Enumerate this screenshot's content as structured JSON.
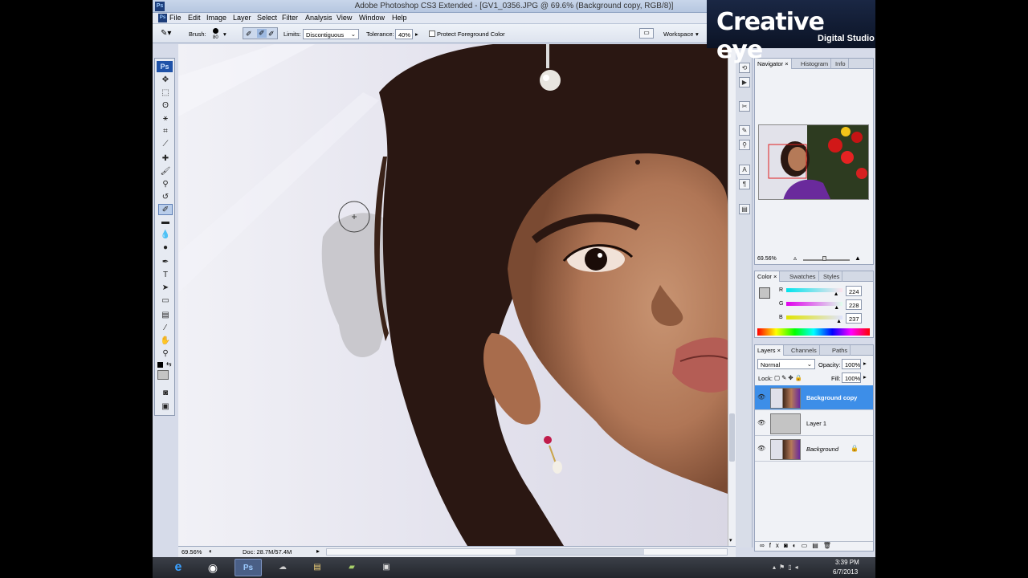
{
  "window": {
    "title": "Adobe Photoshop CS3 Extended - [GV1_0356.JPG @ 69.6% (Background copy, RGB/8)]"
  },
  "logo": {
    "line1": "Creative eye",
    "line2": "Digital Studio"
  },
  "menu": [
    "File",
    "Edit",
    "Image",
    "Layer",
    "Select",
    "Filter",
    "Analysis",
    "View",
    "Window",
    "Help"
  ],
  "options": {
    "brush_label": "Brush:",
    "brush_size": "80",
    "limits_label": "Limits:",
    "limits_value": "Discontiguous",
    "tolerance_label": "Tolerance:",
    "tolerance_value": "40%",
    "protect_label": "Protect Foreground Color",
    "workspace_label": "Workspace"
  },
  "toolbox": {
    "logo": "Ps"
  },
  "status": {
    "zoom": "69.56%",
    "doc": "Doc: 28.7M/57.4M"
  },
  "navigator": {
    "tabs": [
      "Navigator",
      "Histogram",
      "Info"
    ],
    "zoom": "69.56%"
  },
  "color_panel": {
    "tabs": [
      "Color",
      "Swatches",
      "Styles"
    ],
    "channels": [
      {
        "label": "R",
        "value": "224",
        "level": 0.88
      },
      {
        "label": "G",
        "value": "228",
        "level": 0.89
      },
      {
        "label": "B",
        "value": "237",
        "level": 0.93
      }
    ],
    "swatch": "#e0e4ed"
  },
  "layers_panel": {
    "tabs": [
      "Layers",
      "Channels",
      "Paths"
    ],
    "blend_mode": "Normal",
    "opacity_label": "Opacity:",
    "opacity_value": "100%",
    "lock_label": "Lock:",
    "fill_label": "Fill:",
    "fill_value": "100%",
    "layers": [
      {
        "name": "Background copy",
        "selected": true
      },
      {
        "name": "Layer 1",
        "selected": false
      },
      {
        "name": "Background",
        "selected": false
      }
    ]
  },
  "taskbar": {
    "time": "3:39 PM",
    "date": "6/7/2013"
  }
}
